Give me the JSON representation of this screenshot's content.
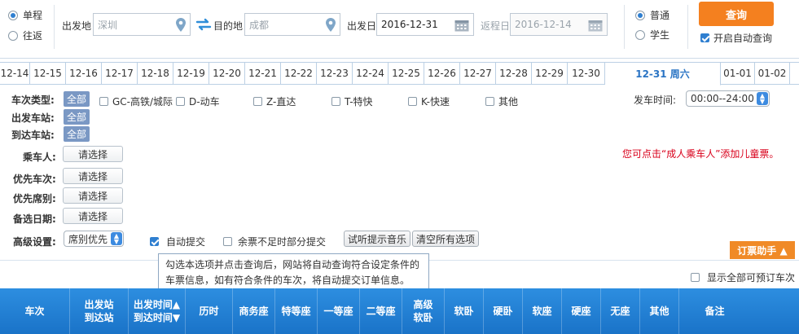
{
  "trip_type": {
    "one_way": "单程",
    "round_trip": "往返",
    "selected": "one_way"
  },
  "from": {
    "label": "出发地",
    "placeholder": "深圳"
  },
  "to": {
    "label": "目的地",
    "placeholder": "成都"
  },
  "depart_date": {
    "label": "出发日",
    "value": "2016-12-31"
  },
  "return_date": {
    "label": "返程日",
    "value": "2016-12-14"
  },
  "ticket_type": {
    "normal": "普通",
    "student": "学生",
    "selected": "normal"
  },
  "query_button": "查询",
  "auto_query": {
    "label": "开启自动查询",
    "checked": true
  },
  "date_tabs": [
    "12-14",
    "12-15",
    "12-16",
    "12-17",
    "12-18",
    "12-19",
    "12-20",
    "12-21",
    "12-22",
    "12-23",
    "12-24",
    "12-25",
    "12-26",
    "12-27",
    "12-28",
    "12-29",
    "12-30",
    "12-31 周六",
    "01-01",
    "01-02"
  ],
  "active_tab": "12-31 周六",
  "filters": {
    "train_type_label": "车次类型:",
    "all_tag": "全部",
    "train_types": [
      "GC-高铁/城际",
      "D-动车",
      "Z-直达",
      "T-特快",
      "K-快速",
      "其他"
    ],
    "depart_time_label": "发车时间:",
    "depart_time_value": "00:00--24:00",
    "depart_station_label": "出发车站:",
    "arrive_station_label": "到达车站:",
    "passenger_label": "乘车人:",
    "priority_train_label": "优先车次:",
    "priority_seat_label": "优先席别:",
    "alt_date_label": "备选日期:",
    "select_btn": "请选择",
    "child_tip": "您可点击“成人乘车人”添加儿童票。",
    "advanced_label": "高级设置:",
    "advanced_value": "席别优先",
    "auto_submit": "自动提交",
    "partial_submit": "余票不足时部分提交",
    "audition_btn": "试听提示音乐",
    "clear_btn": "清空所有选项",
    "assistant_btn": "订票助手 ▲",
    "tooltip": "勾选本选项并点击查询后，网站将自动查询符合设定条件的车票信息，如有符合条件的车次，将自动提交订单信息。",
    "show_all": "显示全部可预订车次"
  },
  "columns": [
    {
      "l1": "车次",
      "l2": ""
    },
    {
      "l1": "出发站",
      "l2": "到达站"
    },
    {
      "l1": "出发时间▲",
      "l2": "到达时间▼"
    },
    {
      "l1": "历时",
      "l2": ""
    },
    {
      "l1": "商务座",
      "l2": ""
    },
    {
      "l1": "特等座",
      "l2": ""
    },
    {
      "l1": "一等座",
      "l2": ""
    },
    {
      "l1": "二等座",
      "l2": ""
    },
    {
      "l1": "高级",
      "l2": "软卧"
    },
    {
      "l1": "软卧",
      "l2": ""
    },
    {
      "l1": "硬卧",
      "l2": ""
    },
    {
      "l1": "软座",
      "l2": ""
    },
    {
      "l1": "硬座",
      "l2": ""
    },
    {
      "l1": "无座",
      "l2": ""
    },
    {
      "l1": "其他",
      "l2": ""
    },
    {
      "l1": "备注",
      "l2": ""
    }
  ],
  "colors": {
    "accent": "#2f7fd0",
    "orange": "#f4801f",
    "header": "#1f7bd0",
    "tip_red": "#d9001b"
  }
}
